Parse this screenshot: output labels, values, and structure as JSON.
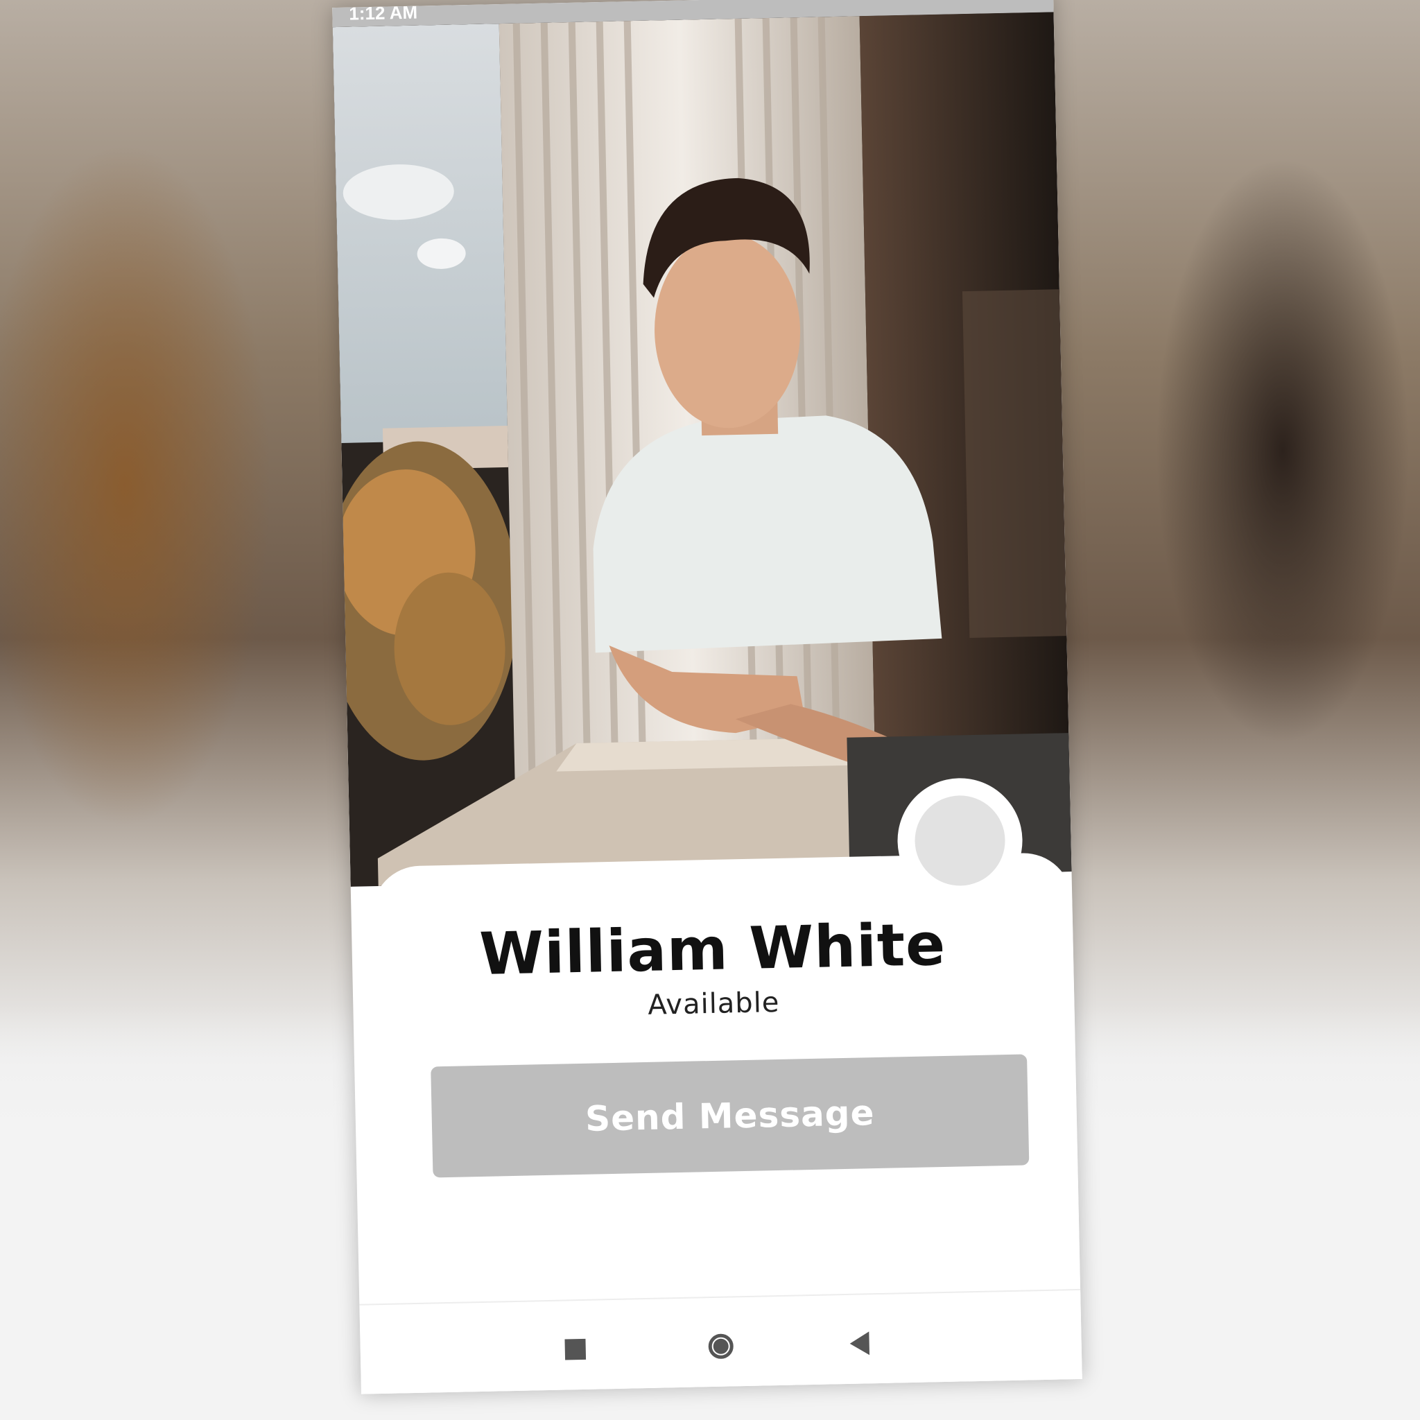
{
  "status_bar": {
    "time": "1:12 AM"
  },
  "profile": {
    "name": "William White",
    "status": "Available",
    "photo_icon": "profile-photo"
  },
  "actions": {
    "send_message_label": "Send Message"
  },
  "nav": {
    "recent_icon": "recent-apps-icon",
    "home_icon": "home-icon",
    "back_icon": "back-icon"
  },
  "colors": {
    "button_bg": "#bdbdbd",
    "button_text": "#ffffff",
    "avatar_placeholder": "#e2e2e2",
    "name_text": "#111111"
  }
}
